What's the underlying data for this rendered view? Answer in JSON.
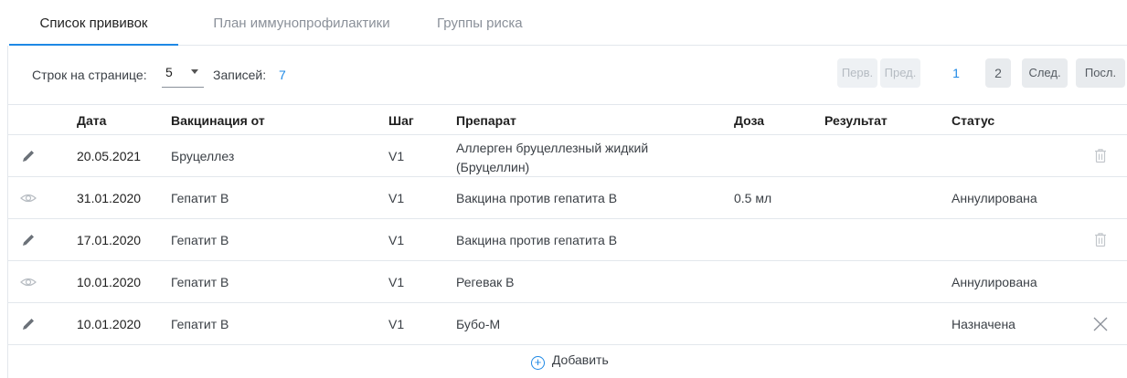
{
  "tabs": [
    {
      "label": "Список прививок",
      "active": true
    },
    {
      "label": "План иммунопрофилактики",
      "active": false
    },
    {
      "label": "Группы риска",
      "active": false
    }
  ],
  "toolbar": {
    "rows_label": "Строк на странице:",
    "rows_value": "5",
    "records_label": "Записей:",
    "records_count": "7"
  },
  "pagination": {
    "first": "Перв.",
    "prev": "Пред.",
    "pages": [
      "1",
      "2"
    ],
    "current_page": "1",
    "next": "След.",
    "last": "Посл."
  },
  "table": {
    "columns": {
      "date": "Дата",
      "vaccination": "Вакцинация от",
      "step": "Шаг",
      "drug": "Препарат",
      "dose": "Доза",
      "result": "Результат",
      "status": "Статус"
    },
    "rows": [
      {
        "icon": "pencil-icon",
        "date": "20.05.2021",
        "vaccination": "Бруцеллез",
        "step": "V1",
        "drug": "Аллерген бруцеллезный жидкий (Бруцеллин)",
        "dose": "",
        "result": "",
        "status": "",
        "action": "trash-icon"
      },
      {
        "icon": "eye-icon",
        "date": "31.01.2020",
        "vaccination": "Гепатит В",
        "step": "V1",
        "drug": "Вакцина против гепатита В",
        "dose": "0.5 мл",
        "result": "",
        "status": "Аннулирована",
        "action": ""
      },
      {
        "icon": "pencil-icon",
        "date": "17.01.2020",
        "vaccination": "Гепатит В",
        "step": "V1",
        "drug": "Вакцина против гепатита В",
        "dose": "",
        "result": "",
        "status": "",
        "action": "trash-icon"
      },
      {
        "icon": "eye-icon",
        "date": "10.01.2020",
        "vaccination": "Гепатит В",
        "step": "V1",
        "drug": "Регевак В",
        "dose": "",
        "result": "",
        "status": "Аннулирована",
        "action": ""
      },
      {
        "icon": "pencil-icon",
        "date": "10.01.2020",
        "vaccination": "Гепатит В",
        "step": "V1",
        "drug": "Бубо-М",
        "dose": "",
        "result": "",
        "status": "Назначена",
        "action": "close-icon"
      }
    ]
  },
  "add_button": {
    "label": "Добавить"
  },
  "colors": {
    "accent": "#1e88e5",
    "border": "#e3e7ec",
    "muted": "#8a9099"
  }
}
